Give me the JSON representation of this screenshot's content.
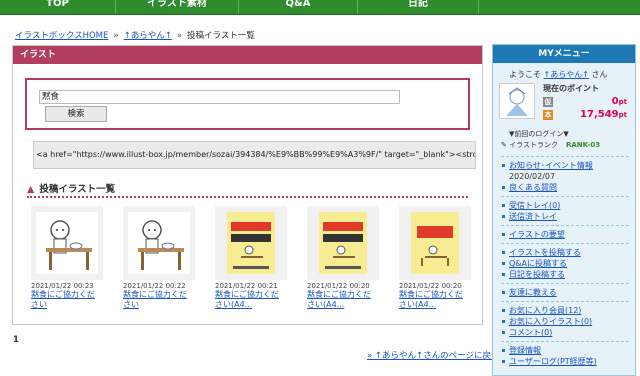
{
  "topnav": {
    "items": [
      "TOP",
      "イラスト素材",
      "Q&A",
      "日記"
    ]
  },
  "breadcrumb": {
    "home": "イラストボックスHOME",
    "user": "↑あらやん↑",
    "current": "投稿イラスト一覧"
  },
  "main": {
    "header": "イラスト",
    "search": {
      "value": "黙食",
      "button": "検索"
    },
    "code": "<a href=\"https://www.illust-box.jp/member/sozai/394384/%E9%BB%99%E9%A3%9F/\" target=\"_blank\"><strong>黙",
    "section_title": "投稿イラスト一覧",
    "items": [
      {
        "date": "2021/01/22 00:23",
        "title_l1": "黙食にご協力くだ",
        "title_l2": "さい"
      },
      {
        "date": "2021/01/22 00:22",
        "title_l1": "黙食にご協力くだ",
        "title_l2": "さい"
      },
      {
        "date": "2021/01/22 00:21",
        "title_l1": "黙食にご協力くだ",
        "title_l2": "さい(A4..."
      },
      {
        "date": "2021/01/22 00:20",
        "title_l1": "黙食にご協力くだ",
        "title_l2": "さい(A4..."
      },
      {
        "date": "2021/01/22 00:20",
        "title_l1": "黙食にご協力くだ",
        "title_l2": "さい(A4..."
      }
    ],
    "page": "1",
    "back_link": "» ↑あらやん↑さんのページに戻る"
  },
  "sidebar": {
    "title": "MYメニュー",
    "welcome_prefix": "ようこそ ",
    "welcome_user": "↑あらやん↑",
    "welcome_suffix": " さん",
    "points_label": "現在のポイント",
    "points": [
      {
        "badge": "仮",
        "value": "0",
        "unit": "pt"
      },
      {
        "badge": "本",
        "value": "17,549",
        "unit": "pt"
      }
    ],
    "last_login": "▼前回のログイン▼",
    "rank_label": "イラストランク",
    "rank_value": "RANK-03",
    "links_1": [
      "お知らせ･イベント情報",
      "2020/02/07",
      "良くある質問"
    ],
    "links_2": [
      "受信トレイ(0)",
      "送信済トレイ"
    ],
    "links_3": [
      "イラストの要望"
    ],
    "links_4": [
      "イラストを投稿する",
      "Q&Aに投稿する",
      "日記を投稿する"
    ],
    "links_5": [
      "友達に教える"
    ],
    "links_6": [
      "お気に入り会員(12)",
      "お気に入りイラスト(0)",
      "コメント(0)"
    ],
    "links_7": [
      "登録情報",
      "ユーザーログ(PT経歴等)"
    ]
  },
  "colors": {
    "nav": "#2e8b2e",
    "accent": "#b23d62",
    "side": "#1f79b7",
    "points": "#e4004f"
  }
}
